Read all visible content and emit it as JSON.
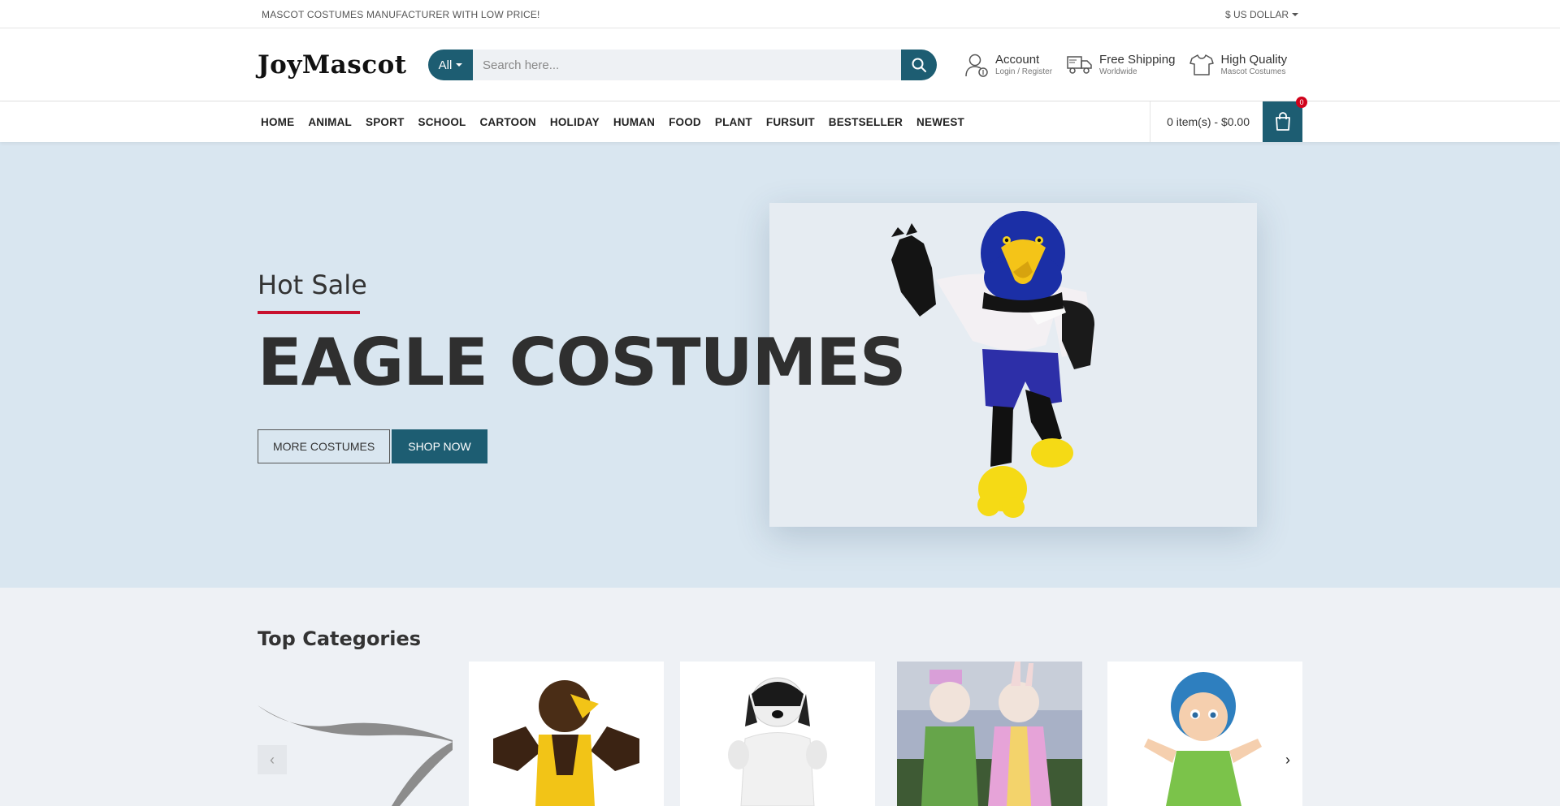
{
  "topbar": {
    "promo": "MASCOT COSTUMES MANUFACTURER WITH LOW PRICE!",
    "currency": "$ US DOLLAR"
  },
  "header": {
    "logo": "JoyMascot",
    "search_category": "All",
    "search_placeholder": "Search here...",
    "account_title": "Account",
    "account_sub": "Login / Register",
    "shipping_title": "Free Shipping",
    "shipping_sub": "Worldwide",
    "quality_title": "High Quality",
    "quality_sub": "Mascot Costumes"
  },
  "nav": {
    "items": [
      "HOME",
      "ANIMAL",
      "SPORT",
      "SCHOOL",
      "CARTOON",
      "HOLIDAY",
      "HUMAN",
      "FOOD",
      "PLANT",
      "FURSUIT",
      "BESTSELLER",
      "NEWEST"
    ],
    "cart_label": "0 item(s) - $0.00",
    "cart_count": "0"
  },
  "hero": {
    "kicker": "Hot Sale",
    "headline": "EAGLE COSTUMES",
    "button_more": "MORE COSTUMES",
    "button_shop": "SHOP NOW"
  },
  "categories": {
    "title": "Top Categories",
    "prev_icon": "‹",
    "next_icon": "›"
  },
  "colors": {
    "brand": "#1d5d72",
    "hero_bg": "#d9e6f0",
    "accent_red": "#c8102e"
  }
}
